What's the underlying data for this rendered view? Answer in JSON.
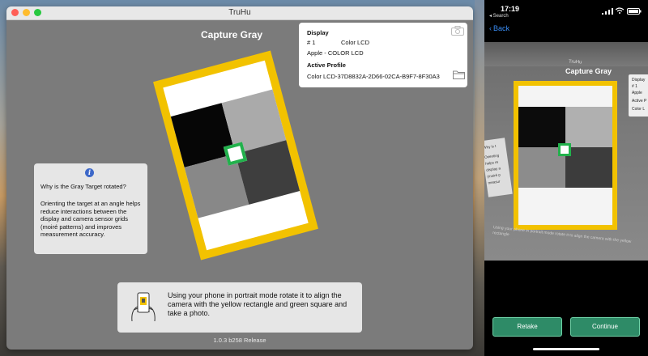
{
  "desktop": {
    "window": {
      "title": "TruHu",
      "heading": "Capture Gray",
      "display_panel": {
        "display_label": "Display",
        "number_prefix": "# 1",
        "display_name": "Color LCD",
        "manufacturer": "Apple - COLOR LCD",
        "profile_label": "Active Profile",
        "profile_value": "Color LCD-37D8832A-2D66-02CA-B9F7-8F30A3"
      },
      "info": {
        "icon": "i",
        "question": "Why is the Gray Target rotated?",
        "answer": "Orienting the target at an angle helps reduce interactions between the display and camera sensor grids (moiré patterns) and improves measurement accuracy."
      },
      "instruction": "Using your phone in portrait mode rotate it to align the camera with the yellow rectangle and green square and take a photo.",
      "version": "1.0.3 b258 Release"
    }
  },
  "phone": {
    "status": {
      "time": "17:19",
      "back_app": "◂ Search"
    },
    "nav": {
      "back_label": "Back",
      "back_chevron": "‹"
    },
    "photo": {
      "window_title": "TruHu",
      "heading": "Capture Gray",
      "panel_lines": [
        "Display",
        "# 1",
        "Apple",
        "Active P",
        "Color L"
      ],
      "left_panel_lines": [
        "Why is t",
        "Orienting",
        "helps re",
        "display a",
        "(moiré p",
        "measur"
      ],
      "bottom_text": "Using your phone in portrait mode rotate it to align the camera with the yellow rectangle"
    },
    "buttons": {
      "retake": "Retake",
      "continue": "Continue"
    }
  },
  "colors": {
    "target_yellow": "#f2c200",
    "green_square": "#22b14c",
    "button_green": "#2e8b67",
    "link_blue": "#3a8df5"
  }
}
